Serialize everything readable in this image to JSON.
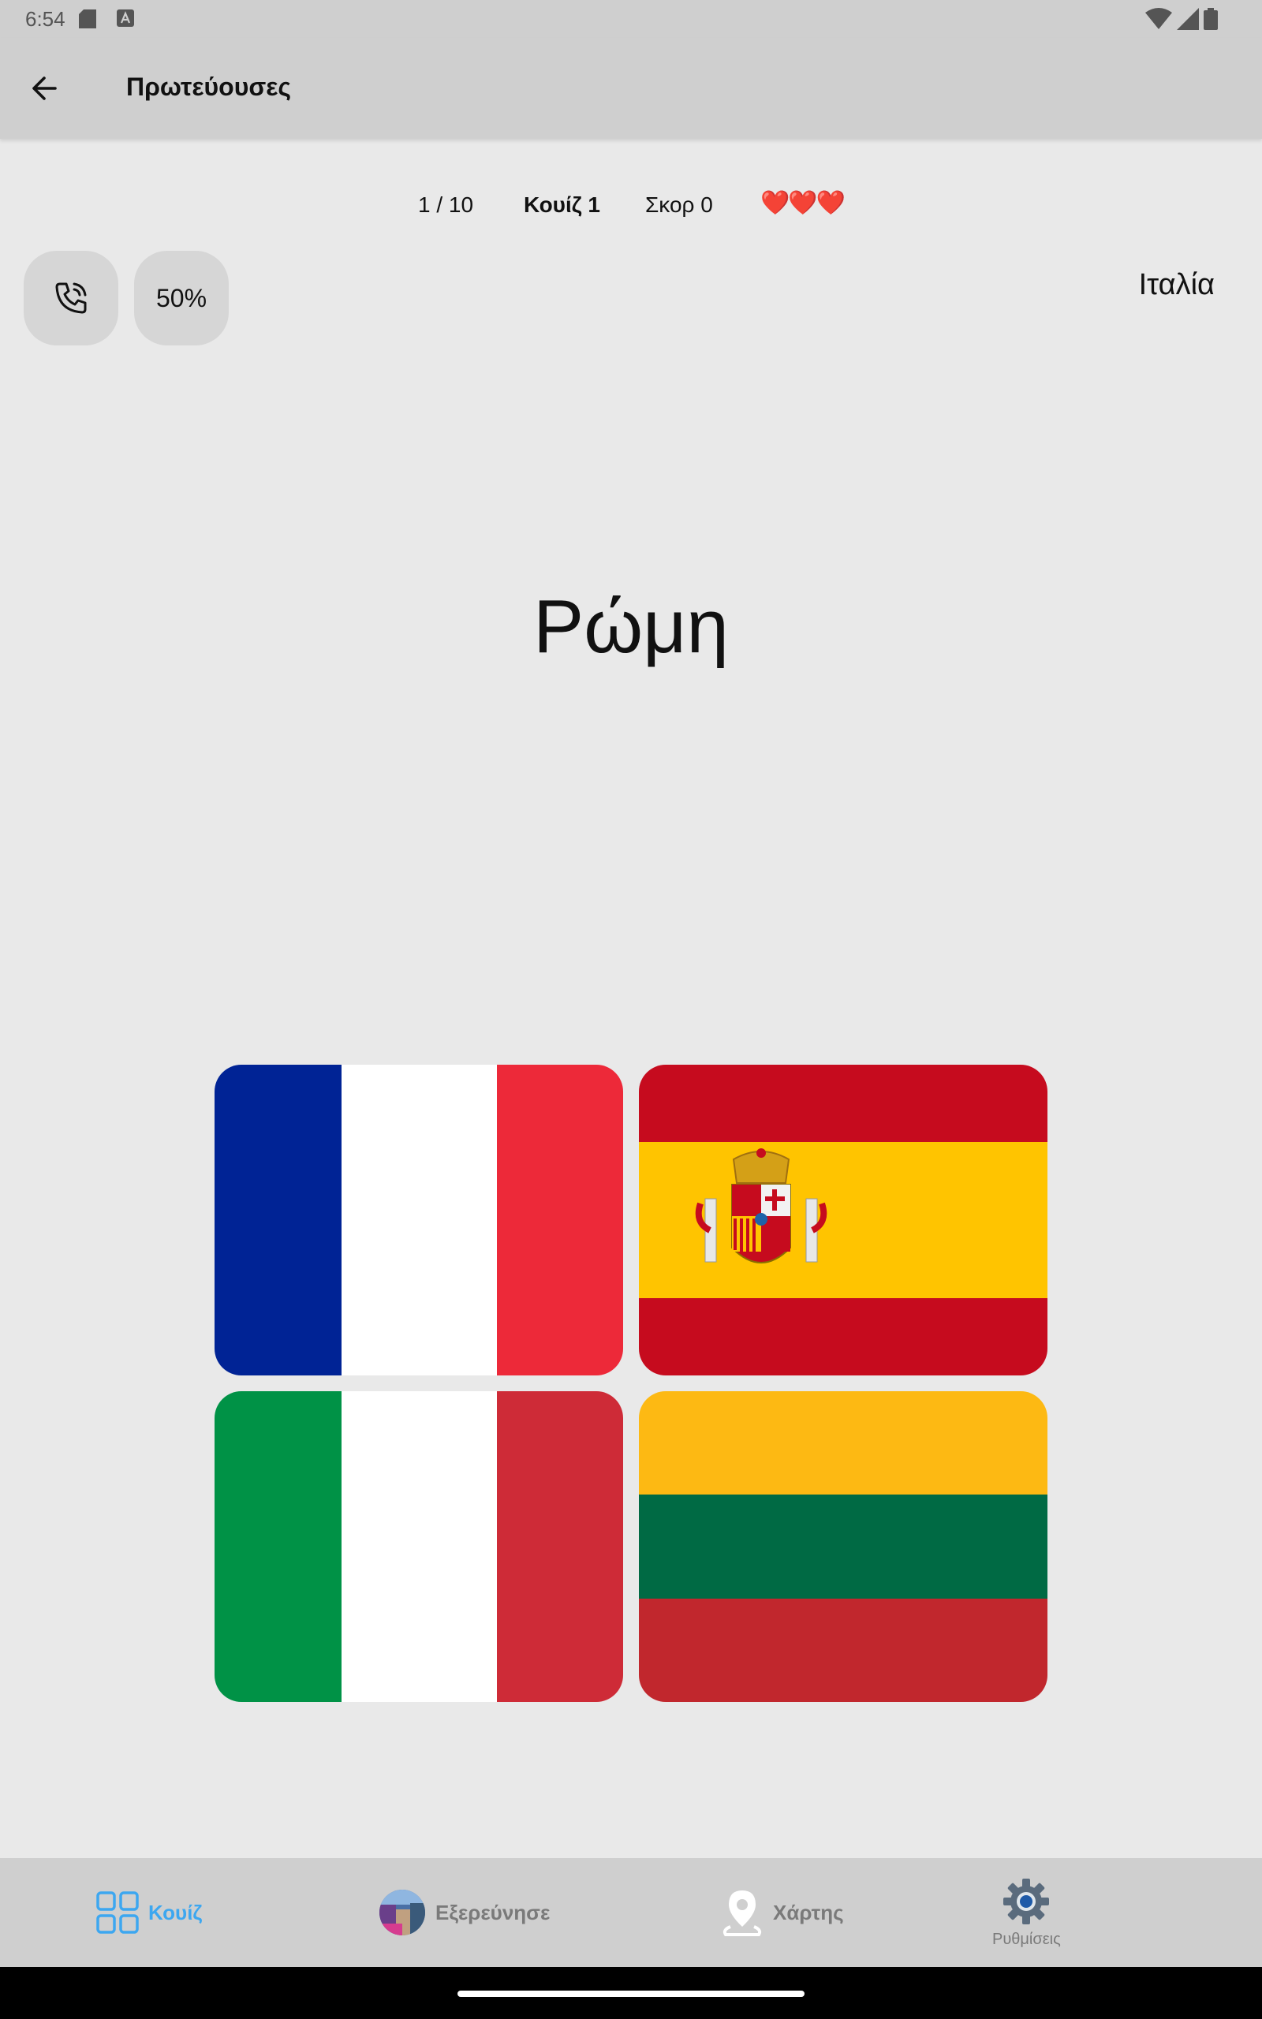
{
  "status_bar": {
    "time": "6:54"
  },
  "app_bar": {
    "title": "Πρωτεύουσες",
    "back_icon": "arrow-left-icon"
  },
  "quiz_info": {
    "progress": "1 / 10",
    "quiz_name": "Κουίζ 1",
    "score": "Σκορ 0",
    "hearts": "❤️❤️❤️"
  },
  "lifelines": {
    "phone_icon": "phone-call-icon",
    "fifty_label": "50%"
  },
  "country_label": "Ιταλία",
  "question": "Ρώμη",
  "options": [
    {
      "flag": "France",
      "colors": [
        "#002395",
        "#ffffff",
        "#ed2939"
      ]
    },
    {
      "flag": "Spain",
      "colors": [
        "#c60b1e",
        "#ffc400",
        "#c60b1e"
      ]
    },
    {
      "flag": "Italy",
      "colors": [
        "#009246",
        "#ffffff",
        "#ce2b37"
      ]
    },
    {
      "flag": "Lithuania",
      "colors": [
        "#fdb913",
        "#006a44",
        "#c1272d"
      ]
    }
  ],
  "bottom_nav": {
    "quiz": "Κουίζ",
    "explore": "Εξερεύνησε",
    "map": "Χάρτης",
    "settings": "Ρυθμίσεις",
    "active_color": "#3da7f0"
  }
}
